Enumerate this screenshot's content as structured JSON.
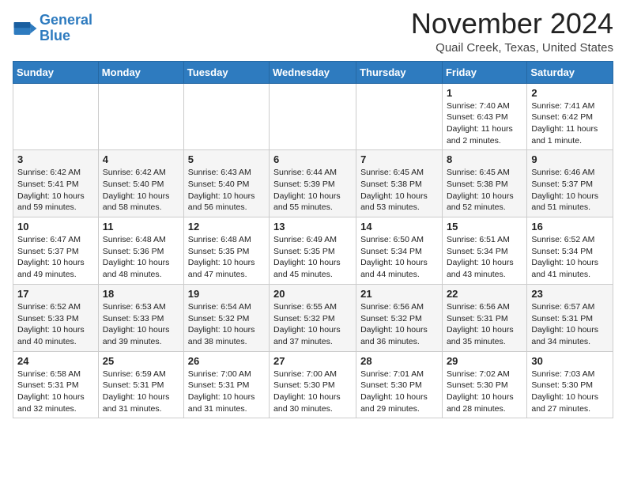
{
  "header": {
    "logo_line1": "General",
    "logo_line2": "Blue",
    "month_title": "November 2024",
    "location": "Quail Creek, Texas, United States"
  },
  "weekdays": [
    "Sunday",
    "Monday",
    "Tuesday",
    "Wednesday",
    "Thursday",
    "Friday",
    "Saturday"
  ],
  "weeks": [
    [
      {
        "day": "",
        "info": ""
      },
      {
        "day": "",
        "info": ""
      },
      {
        "day": "",
        "info": ""
      },
      {
        "day": "",
        "info": ""
      },
      {
        "day": "",
        "info": ""
      },
      {
        "day": "1",
        "info": "Sunrise: 7:40 AM\nSunset: 6:43 PM\nDaylight: 11 hours\nand 2 minutes."
      },
      {
        "day": "2",
        "info": "Sunrise: 7:41 AM\nSunset: 6:42 PM\nDaylight: 11 hours\nand 1 minute."
      }
    ],
    [
      {
        "day": "3",
        "info": "Sunrise: 6:42 AM\nSunset: 5:41 PM\nDaylight: 10 hours\nand 59 minutes."
      },
      {
        "day": "4",
        "info": "Sunrise: 6:42 AM\nSunset: 5:40 PM\nDaylight: 10 hours\nand 58 minutes."
      },
      {
        "day": "5",
        "info": "Sunrise: 6:43 AM\nSunset: 5:40 PM\nDaylight: 10 hours\nand 56 minutes."
      },
      {
        "day": "6",
        "info": "Sunrise: 6:44 AM\nSunset: 5:39 PM\nDaylight: 10 hours\nand 55 minutes."
      },
      {
        "day": "7",
        "info": "Sunrise: 6:45 AM\nSunset: 5:38 PM\nDaylight: 10 hours\nand 53 minutes."
      },
      {
        "day": "8",
        "info": "Sunrise: 6:45 AM\nSunset: 5:38 PM\nDaylight: 10 hours\nand 52 minutes."
      },
      {
        "day": "9",
        "info": "Sunrise: 6:46 AM\nSunset: 5:37 PM\nDaylight: 10 hours\nand 51 minutes."
      }
    ],
    [
      {
        "day": "10",
        "info": "Sunrise: 6:47 AM\nSunset: 5:37 PM\nDaylight: 10 hours\nand 49 minutes."
      },
      {
        "day": "11",
        "info": "Sunrise: 6:48 AM\nSunset: 5:36 PM\nDaylight: 10 hours\nand 48 minutes."
      },
      {
        "day": "12",
        "info": "Sunrise: 6:48 AM\nSunset: 5:35 PM\nDaylight: 10 hours\nand 47 minutes."
      },
      {
        "day": "13",
        "info": "Sunrise: 6:49 AM\nSunset: 5:35 PM\nDaylight: 10 hours\nand 45 minutes."
      },
      {
        "day": "14",
        "info": "Sunrise: 6:50 AM\nSunset: 5:34 PM\nDaylight: 10 hours\nand 44 minutes."
      },
      {
        "day": "15",
        "info": "Sunrise: 6:51 AM\nSunset: 5:34 PM\nDaylight: 10 hours\nand 43 minutes."
      },
      {
        "day": "16",
        "info": "Sunrise: 6:52 AM\nSunset: 5:34 PM\nDaylight: 10 hours\nand 41 minutes."
      }
    ],
    [
      {
        "day": "17",
        "info": "Sunrise: 6:52 AM\nSunset: 5:33 PM\nDaylight: 10 hours\nand 40 minutes."
      },
      {
        "day": "18",
        "info": "Sunrise: 6:53 AM\nSunset: 5:33 PM\nDaylight: 10 hours\nand 39 minutes."
      },
      {
        "day": "19",
        "info": "Sunrise: 6:54 AM\nSunset: 5:32 PM\nDaylight: 10 hours\nand 38 minutes."
      },
      {
        "day": "20",
        "info": "Sunrise: 6:55 AM\nSunset: 5:32 PM\nDaylight: 10 hours\nand 37 minutes."
      },
      {
        "day": "21",
        "info": "Sunrise: 6:56 AM\nSunset: 5:32 PM\nDaylight: 10 hours\nand 36 minutes."
      },
      {
        "day": "22",
        "info": "Sunrise: 6:56 AM\nSunset: 5:31 PM\nDaylight: 10 hours\nand 35 minutes."
      },
      {
        "day": "23",
        "info": "Sunrise: 6:57 AM\nSunset: 5:31 PM\nDaylight: 10 hours\nand 34 minutes."
      }
    ],
    [
      {
        "day": "24",
        "info": "Sunrise: 6:58 AM\nSunset: 5:31 PM\nDaylight: 10 hours\nand 32 minutes."
      },
      {
        "day": "25",
        "info": "Sunrise: 6:59 AM\nSunset: 5:31 PM\nDaylight: 10 hours\nand 31 minutes."
      },
      {
        "day": "26",
        "info": "Sunrise: 7:00 AM\nSunset: 5:31 PM\nDaylight: 10 hours\nand 31 minutes."
      },
      {
        "day": "27",
        "info": "Sunrise: 7:00 AM\nSunset: 5:30 PM\nDaylight: 10 hours\nand 30 minutes."
      },
      {
        "day": "28",
        "info": "Sunrise: 7:01 AM\nSunset: 5:30 PM\nDaylight: 10 hours\nand 29 minutes."
      },
      {
        "day": "29",
        "info": "Sunrise: 7:02 AM\nSunset: 5:30 PM\nDaylight: 10 hours\nand 28 minutes."
      },
      {
        "day": "30",
        "info": "Sunrise: 7:03 AM\nSunset: 5:30 PM\nDaylight: 10 hours\nand 27 minutes."
      }
    ]
  ]
}
